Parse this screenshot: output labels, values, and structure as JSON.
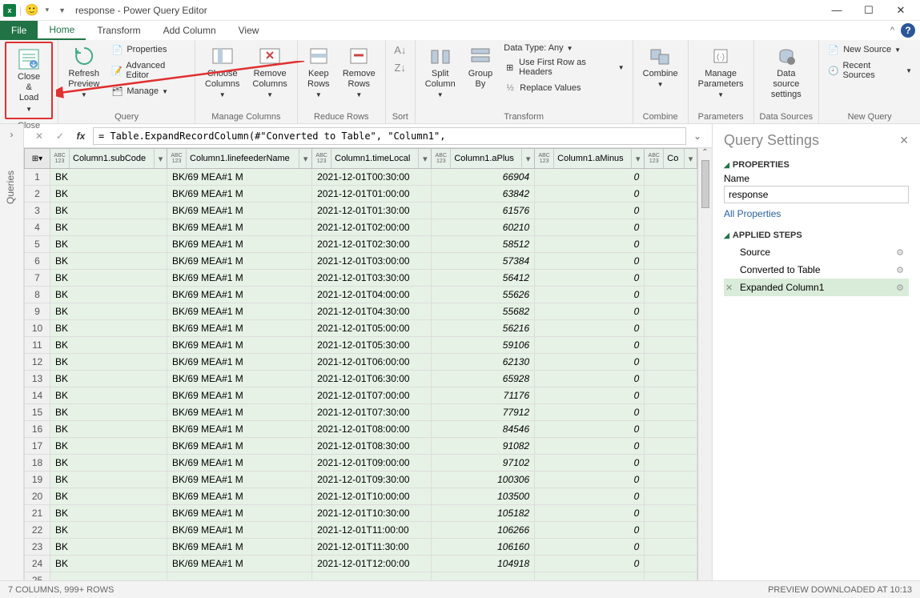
{
  "window": {
    "title": "response - Power Query Editor"
  },
  "tabs": {
    "file": "File",
    "items": [
      "Home",
      "Transform",
      "Add Column",
      "View"
    ],
    "active": "Home"
  },
  "ribbon": {
    "close": {
      "close_load": "Close &\nLoad",
      "group": "Close"
    },
    "query": {
      "refresh": "Refresh\nPreview",
      "properties": "Properties",
      "adv": "Advanced Editor",
      "manage": "Manage",
      "group": "Query"
    },
    "managecols": {
      "choose": "Choose\nColumns",
      "remove": "Remove\nColumns",
      "group": "Manage Columns"
    },
    "reducerows": {
      "keep": "Keep\nRows",
      "remove": "Remove\nRows",
      "group": "Reduce Rows"
    },
    "sort": {
      "group": "Sort"
    },
    "transform": {
      "split": "Split\nColumn",
      "group_by": "Group\nBy",
      "datatype": "Data Type: Any",
      "firstrow": "Use First Row as Headers",
      "replace": "Replace Values",
      "group": "Transform"
    },
    "combine": {
      "combine": "Combine",
      "group": "Combine"
    },
    "params": {
      "manage": "Manage\nParameters",
      "group": "Parameters"
    },
    "ds": {
      "settings": "Data source\nsettings",
      "group": "Data Sources"
    },
    "nq": {
      "new": "New Source",
      "recent": "Recent Sources",
      "group": "New Query"
    }
  },
  "queries_label": "Queries",
  "formula": "= Table.ExpandRecordColumn(#\"Converted to Table\", \"Column1\",",
  "columns": [
    "Column1.subCode",
    "Column1.linefeederName",
    "Column1.timeLocal",
    "Column1.aPlus",
    "Column1.aMinus",
    "Co"
  ],
  "rows": [
    [
      "BK",
      "BK/69 MEA#1 M",
      "2021-12-01T00:30:00",
      "66904",
      "0"
    ],
    [
      "BK",
      "BK/69 MEA#1 M",
      "2021-12-01T01:00:00",
      "63842",
      "0"
    ],
    [
      "BK",
      "BK/69 MEA#1 M",
      "2021-12-01T01:30:00",
      "61576",
      "0"
    ],
    [
      "BK",
      "BK/69 MEA#1 M",
      "2021-12-01T02:00:00",
      "60210",
      "0"
    ],
    [
      "BK",
      "BK/69 MEA#1 M",
      "2021-12-01T02:30:00",
      "58512",
      "0"
    ],
    [
      "BK",
      "BK/69 MEA#1 M",
      "2021-12-01T03:00:00",
      "57384",
      "0"
    ],
    [
      "BK",
      "BK/69 MEA#1 M",
      "2021-12-01T03:30:00",
      "56412",
      "0"
    ],
    [
      "BK",
      "BK/69 MEA#1 M",
      "2021-12-01T04:00:00",
      "55626",
      "0"
    ],
    [
      "BK",
      "BK/69 MEA#1 M",
      "2021-12-01T04:30:00",
      "55682",
      "0"
    ],
    [
      "BK",
      "BK/69 MEA#1 M",
      "2021-12-01T05:00:00",
      "56216",
      "0"
    ],
    [
      "BK",
      "BK/69 MEA#1 M",
      "2021-12-01T05:30:00",
      "59106",
      "0"
    ],
    [
      "BK",
      "BK/69 MEA#1 M",
      "2021-12-01T06:00:00",
      "62130",
      "0"
    ],
    [
      "BK",
      "BK/69 MEA#1 M",
      "2021-12-01T06:30:00",
      "65928",
      "0"
    ],
    [
      "BK",
      "BK/69 MEA#1 M",
      "2021-12-01T07:00:00",
      "71176",
      "0"
    ],
    [
      "BK",
      "BK/69 MEA#1 M",
      "2021-12-01T07:30:00",
      "77912",
      "0"
    ],
    [
      "BK",
      "BK/69 MEA#1 M",
      "2021-12-01T08:00:00",
      "84546",
      "0"
    ],
    [
      "BK",
      "BK/69 MEA#1 M",
      "2021-12-01T08:30:00",
      "91082",
      "0"
    ],
    [
      "BK",
      "BK/69 MEA#1 M",
      "2021-12-01T09:00:00",
      "97102",
      "0"
    ],
    [
      "BK",
      "BK/69 MEA#1 M",
      "2021-12-01T09:30:00",
      "100306",
      "0"
    ],
    [
      "BK",
      "BK/69 MEA#1 M",
      "2021-12-01T10:00:00",
      "103500",
      "0"
    ],
    [
      "BK",
      "BK/69 MEA#1 M",
      "2021-12-01T10:30:00",
      "105182",
      "0"
    ],
    [
      "BK",
      "BK/69 MEA#1 M",
      "2021-12-01T11:00:00",
      "106266",
      "0"
    ],
    [
      "BK",
      "BK/69 MEA#1 M",
      "2021-12-01T11:30:00",
      "106160",
      "0"
    ],
    [
      "BK",
      "BK/69 MEA#1 M",
      "2021-12-01T12:00:00",
      "104918",
      "0"
    ]
  ],
  "settings": {
    "title": "Query Settings",
    "properties": "PROPERTIES",
    "name_label": "Name",
    "name_value": "response",
    "all_props": "All Properties",
    "steps_label": "APPLIED STEPS",
    "steps": [
      "Source",
      "Converted to Table",
      "Expanded Column1"
    ]
  },
  "status": {
    "left": "7 COLUMNS, 999+ ROWS",
    "right": "PREVIEW DOWNLOADED AT 10:13"
  }
}
